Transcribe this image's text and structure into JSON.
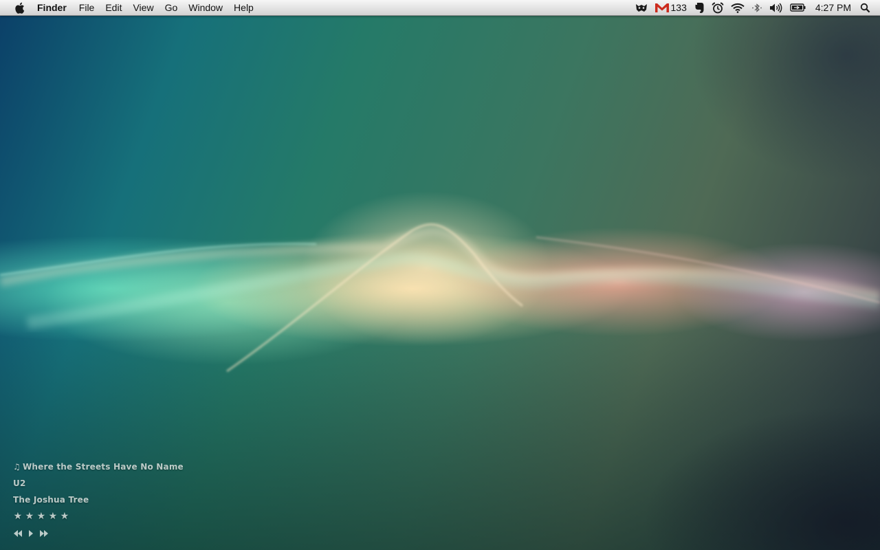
{
  "menubar": {
    "app_name": "Finder",
    "menus": [
      "File",
      "Edit",
      "View",
      "Go",
      "Window",
      "Help"
    ],
    "gmail_unread_count": "133",
    "clock": "4:27 PM",
    "status_icons": [
      "growl-icon",
      "gmail-icon",
      "evernote-icon",
      "alarm-clock-icon",
      "wifi-icon",
      "bluetooth-icon",
      "volume-icon",
      "battery-icon",
      "spotlight-icon"
    ]
  },
  "now_playing": {
    "note_glyph": "♫",
    "track": "Where the Streets Have No Name",
    "artist": "U2",
    "album": "The Joshua Tree",
    "rating": 0,
    "max_rating": 5,
    "star_glyph": "★"
  },
  "colors": {
    "gmail_red": "#cc2b1d",
    "widget_text": "#e1e8e4"
  }
}
